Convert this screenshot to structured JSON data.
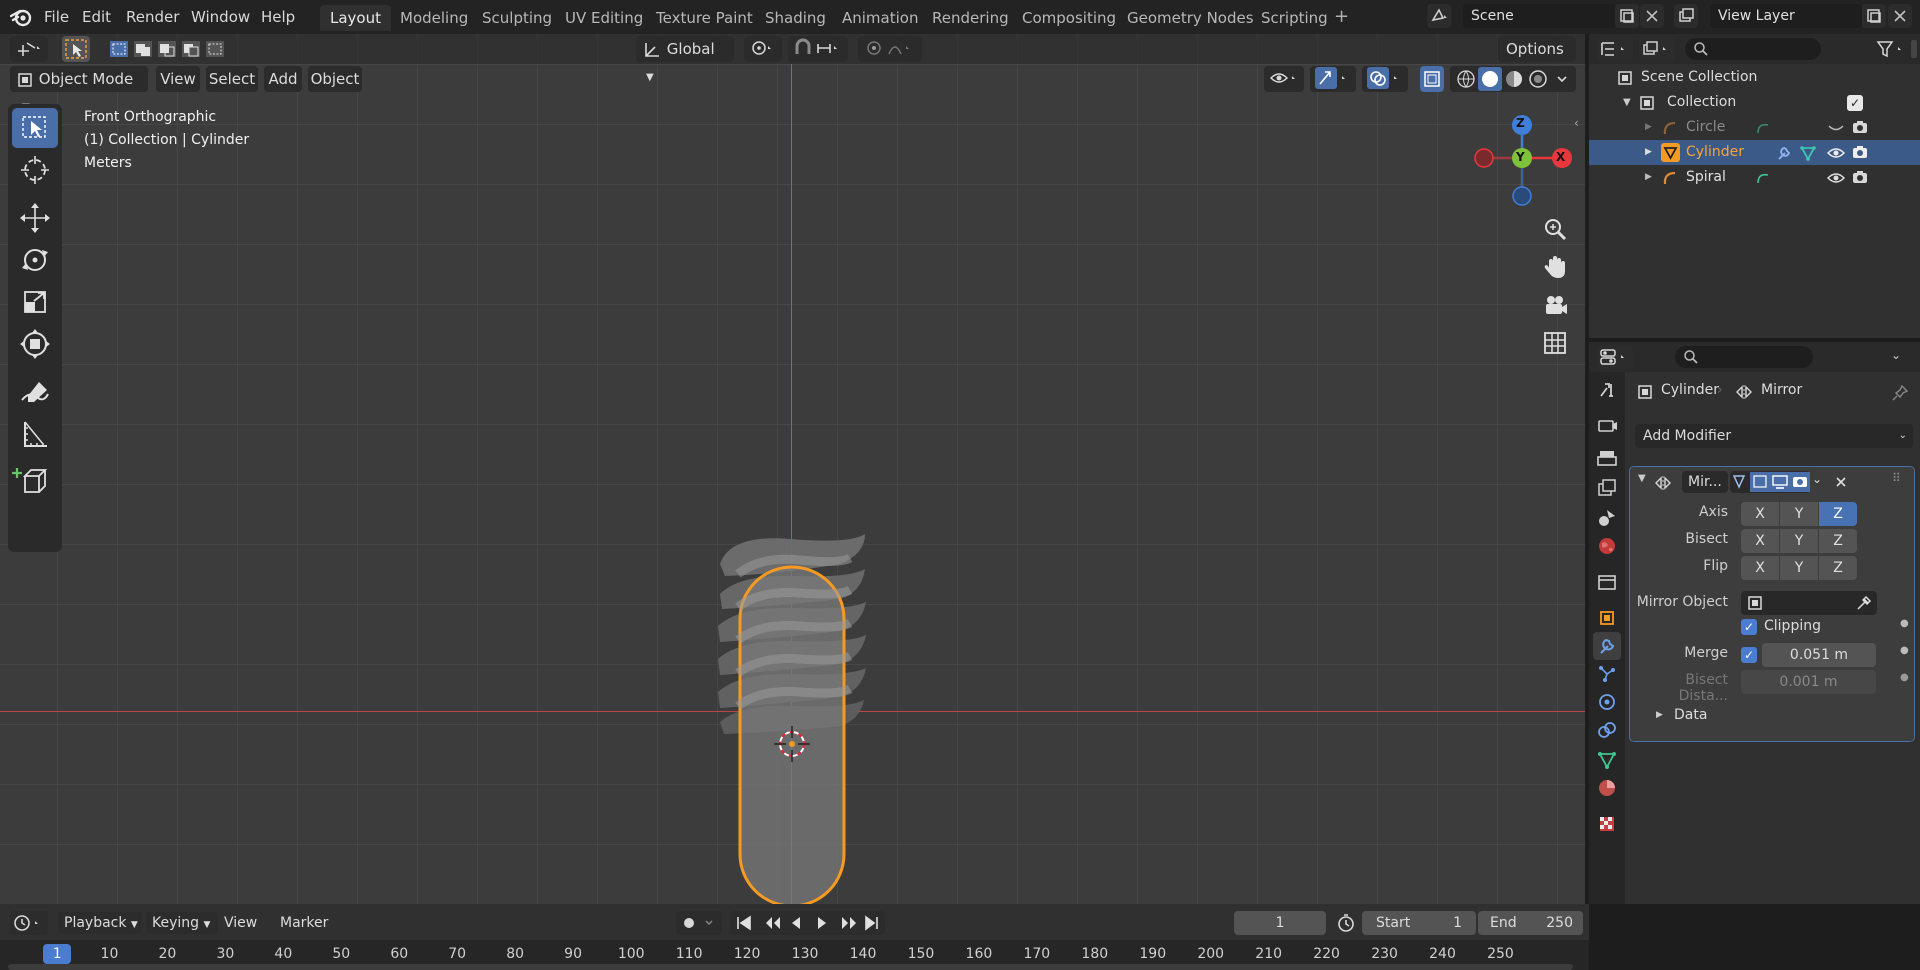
{
  "app": {
    "logo": "blender-logo-icon"
  },
  "menu": [
    "File",
    "Edit",
    "Render",
    "Window",
    "Help"
  ],
  "workspaces": [
    "Layout",
    "Modeling",
    "Sculpting",
    "UV Editing",
    "Texture Paint",
    "Shading",
    "Animation",
    "Rendering",
    "Compositing",
    "Geometry Nodes",
    "Scripting"
  ],
  "active_workspace": "Layout",
  "scene": {
    "name": "Scene"
  },
  "view_layer": {
    "name": "View Layer"
  },
  "viewport": {
    "transform_orientation": "Global",
    "options_label": "Options",
    "mode": "Object Mode",
    "header_menu": [
      "View",
      "Select",
      "Add",
      "Object"
    ],
    "overlay_text": [
      "Front Orthographic",
      "(1) Collection | Cylinder",
      "Meters"
    ],
    "gizmo": {
      "z": "Z",
      "y": "Y",
      "x": "X"
    },
    "colors": {
      "x_axis": "#e8383d",
      "y_axis": "#7dc23a",
      "z_axis": "#3f7fd9",
      "selection": "#f59a22"
    }
  },
  "outliner": {
    "root": "Scene Collection",
    "collection": "Collection",
    "items": [
      {
        "name": "Circle",
        "selected": false,
        "dimmed": true
      },
      {
        "name": "Cylinder",
        "selected": true,
        "dimmed": false
      },
      {
        "name": "Spiral",
        "selected": false,
        "dimmed": false
      }
    ]
  },
  "properties": {
    "object": "Cylinder",
    "modifier_context": "Mirror",
    "add_modifier": "Add Modifier",
    "modifier": {
      "name": "Mir...",
      "axis_label": "Axis",
      "bisect_label": "Bisect",
      "flip_label": "Flip",
      "axis_buttons": [
        "X",
        "Y",
        "Z"
      ],
      "axis_active": "Z",
      "mirror_object_label": "Mirror Object",
      "clipping_label": "Clipping",
      "clipping": true,
      "merge_label": "Merge",
      "merge": true,
      "merge_value": "0.051 m",
      "bisect_distance_label": "Bisect Dista...",
      "bisect_distance_value": "0.001 m",
      "data_label": "Data"
    }
  },
  "timeline": {
    "menu": [
      "Playback",
      "Keying",
      "View",
      "Marker"
    ],
    "current_frame": "1",
    "start_label": "Start",
    "start": "1",
    "end_label": "End",
    "end": "250",
    "ruler": [
      "1",
      "10",
      "20",
      "30",
      "40",
      "50",
      "60",
      "70",
      "80",
      "90",
      "100",
      "110",
      "120",
      "130",
      "140",
      "150",
      "160",
      "170",
      "180",
      "190",
      "200",
      "210",
      "220",
      "230",
      "240",
      "250"
    ]
  }
}
